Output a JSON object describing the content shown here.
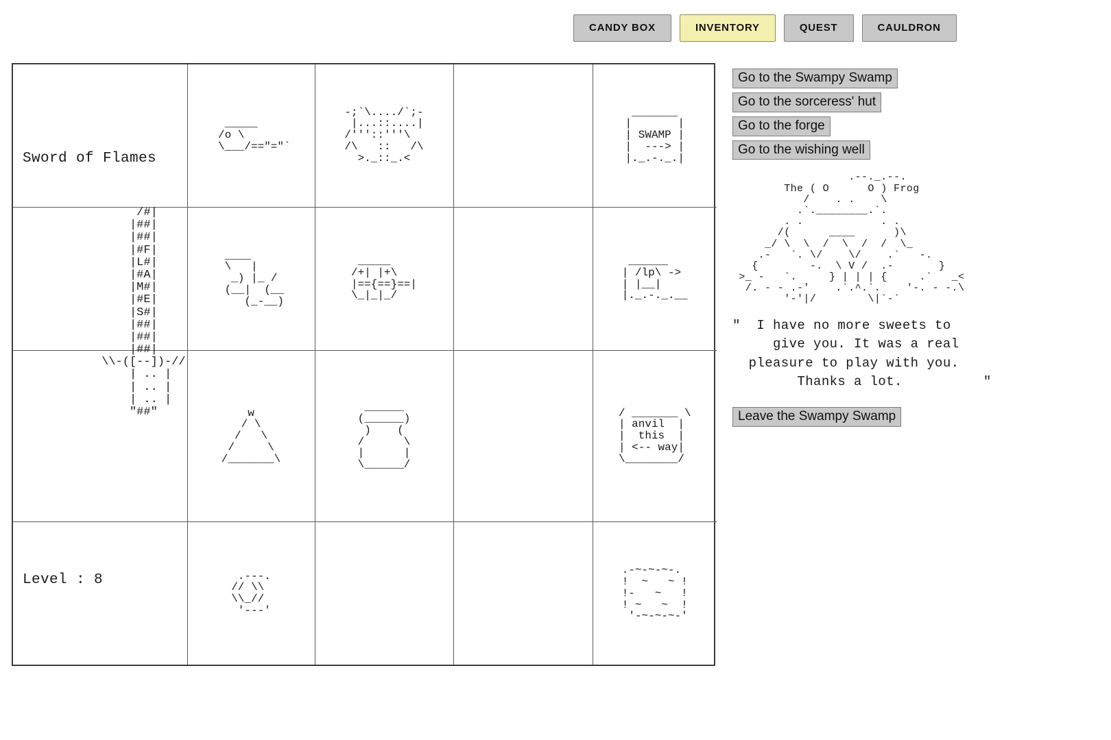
{
  "tabs": [
    {
      "label": "CANDY BOX",
      "selected": false
    },
    {
      "label": "INVENTORY",
      "selected": true
    },
    {
      "label": "QUEST",
      "selected": false
    },
    {
      "label": "CAULDRON",
      "selected": false
    }
  ],
  "colors": {
    "tab_background": "#c8c8c8",
    "tab_selected_background": "#f4f0b0",
    "tab_border": "#808080",
    "grid_border": "#3c3c3c",
    "button_background": "#c8c8c8",
    "text": "#1a1a1a"
  },
  "player": {
    "weapon_name": "Sword of Flames",
    "level_label": "Level : 8",
    "weapon_art": "       /#|\n      |##|\n      |##|\n      |#F|\n      |L#|\n      |#A|\n      |M#|\n      |#E|\n      |S#|\n      |##|\n      |##|\n      |##|\n  \\\\-([--])-//\n      | .. |\n      | .. |\n      | .. |\n      \"##\""
  },
  "inventory": {
    "rows": [
      {
        "name": "Sword of Flames",
        "items": [
          {
            "id": "item-key",
            "art": "  _____\n /o \\\n \\___/==\"=\"`"
          },
          {
            "id": "item-chest-open",
            "art": "-;`\\..../`;-\n |...::....|\n/'''::'''\\\n/\\   ::   /\\\n  >._::_.<"
          },
          {
            "id": "item-empty-1",
            "art": ""
          },
          {
            "id": "item-sign-swamp",
            "art": " _______\n|       |\n| SWAMP |\n|  ---> |\n|._.-._.|"
          }
        ]
      },
      {
        "name": "",
        "items": [
          {
            "id": "item-broken-armor",
            "art": " ____\n \\   |\n  _) |_ /\n (__|  (__\n    (_-__)"
          },
          {
            "id": "item-chest-closed",
            "art": " _____\n/+| |+\\\n|=={==}==|\n\\_|_|_/"
          },
          {
            "id": "item-empty-2",
            "art": ""
          },
          {
            "id": "item-sign-shop",
            "art": " ______\n| /lp\\ ->\n| |__|\n|._.-._.__"
          }
        ]
      },
      {
        "name": "",
        "items": [
          {
            "id": "item-pyramid",
            "art": "    w\n   / \\\n  /   \\\n /     \\\n/_______\\"
          },
          {
            "id": "item-jar",
            "art": " ______\n(______)\n )    (\n/      \\\n|      |\n\\______/"
          },
          {
            "id": "item-empty-3",
            "art": ""
          },
          {
            "id": "item-sign-anvil",
            "art": "/ _______ \\\n| anvil  |\n|  this  |\n| <-- way|\n\\________/"
          }
        ]
      },
      {
        "name": "",
        "items": [
          {
            "id": "item-hexagon",
            "art": " .---.\n// \\\\\n\\\\_//\n '---'"
          },
          {
            "id": "item-empty-4",
            "art": ""
          },
          {
            "id": "item-empty-5",
            "art": ""
          },
          {
            "id": "item-pond",
            "art": ".-~-~-~-.\n!  ~   ~ !\n!-   ~   !\n! ~   ~  !\n '-~-~-~-'"
          }
        ]
      }
    ]
  },
  "location": {
    "nav_buttons": [
      "Go to the Swampy Swamp",
      "Go to the sorceress' hut",
      "Go to the forge",
      "Go to the wishing well"
    ],
    "leave_button": "Leave the Swampy Swamp",
    "npc_name": "The Frog",
    "npc_art": "                  .--._.--.\n        The ( O      O ) Frog\n           /    . .    \\\n          .`.________.`.\n        . .            . .\n       /(      ____      )\\\n     _/ \\  \\  /  \\  /  /  \\_\n    .-   `. \\/    \\/    .`   -.\n   {        -.  \\ V /  .-       }\n >_ -   `.     } | | | {     .`   _<\n  /. - - .-'    .`.^.`.    '-. - -.\\\n        '-'|/        \\|`-`",
    "npc_speech": "\"  I have no more sweets to\n     give you. It was a real\n  pleasure to play with you.\n        Thanks a lot.          \""
  }
}
